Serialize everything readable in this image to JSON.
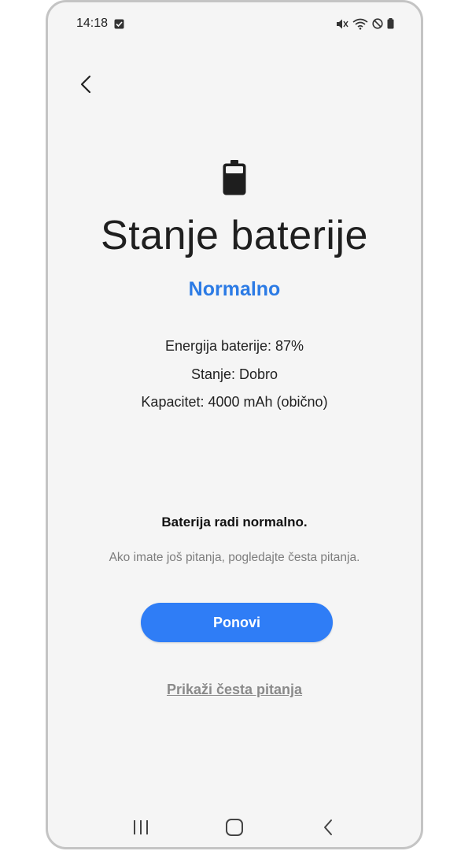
{
  "status_bar": {
    "time": "14:18",
    "icons": [
      "notification-check-icon",
      "mute-icon",
      "wifi-icon",
      "do-not-disturb-icon",
      "battery-icon"
    ]
  },
  "header": {
    "back_icon": "chevron-left-icon"
  },
  "main": {
    "hero_icon": "battery-icon",
    "title": "Stanje baterije",
    "status": "Normalno",
    "info": {
      "energy": "Energija baterije: 87%",
      "condition": "Stanje: Dobro",
      "capacity": "Kapacitet: 4000 mAh (obično)"
    },
    "summary": "Baterija radi normalno.",
    "hint": "Ako imate još pitanja, pogledajte česta pitanja.",
    "retry_label": "Ponovi",
    "faq_link": "Prikaži česta pitanja"
  },
  "navigation": {
    "items": [
      "recent-apps-icon",
      "home-icon",
      "back-icon"
    ]
  },
  "colors": {
    "accent": "#2c7be5",
    "button": "#2f7df6",
    "background": "#f5f5f5",
    "link": "#8a8a8a"
  }
}
